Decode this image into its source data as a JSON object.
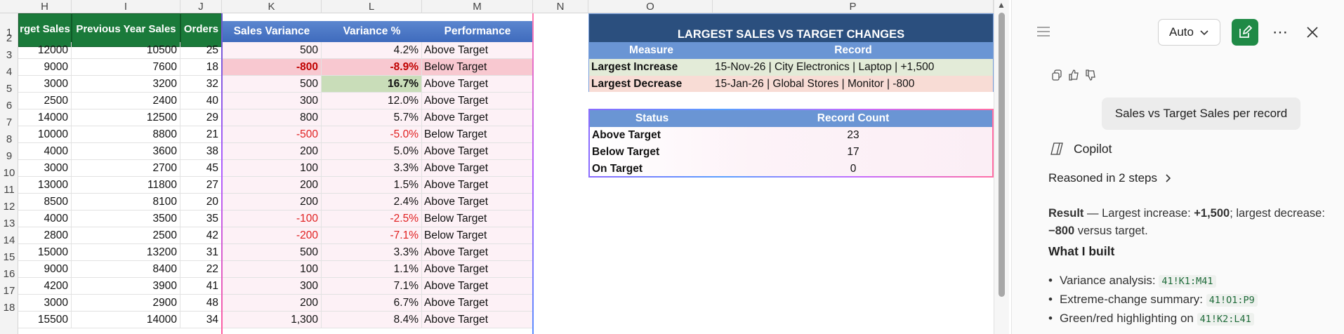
{
  "columns": [
    "H",
    "I",
    "J",
    "K",
    "L",
    "M",
    "N",
    "O",
    "P"
  ],
  "rows": [
    "1",
    "2",
    "3",
    "4",
    "5",
    "6",
    "7",
    "8",
    "9",
    "10",
    "11",
    "12",
    "13",
    "14",
    "15",
    "16",
    "17",
    "18"
  ],
  "headers": {
    "h": "rget Sales",
    "i": "Previous Year Sales",
    "j": "Orders",
    "k": "Sales Variance",
    "l": "Variance %",
    "m": "Performance"
  },
  "table_rows": [
    {
      "h": "12000",
      "i": "10500",
      "j": "25",
      "k": "500",
      "l": "4.2%",
      "m": "Above Target"
    },
    {
      "h": "9000",
      "i": "7600",
      "j": "18",
      "k": "-800",
      "l": "-8.9%",
      "m": "Below Target"
    },
    {
      "h": "3000",
      "i": "3200",
      "j": "32",
      "k": "500",
      "l": "16.7%",
      "m": "Above Target"
    },
    {
      "h": "2500",
      "i": "2400",
      "j": "40",
      "k": "300",
      "l": "12.0%",
      "m": "Above Target"
    },
    {
      "h": "14000",
      "i": "12500",
      "j": "29",
      "k": "800",
      "l": "5.7%",
      "m": "Above Target"
    },
    {
      "h": "10000",
      "i": "8800",
      "j": "21",
      "k": "-500",
      "l": "-5.0%",
      "m": "Below Target"
    },
    {
      "h": "4000",
      "i": "3600",
      "j": "38",
      "k": "200",
      "l": "5.0%",
      "m": "Above Target"
    },
    {
      "h": "3000",
      "i": "2700",
      "j": "45",
      "k": "100",
      "l": "3.3%",
      "m": "Above Target"
    },
    {
      "h": "13000",
      "i": "11800",
      "j": "27",
      "k": "200",
      "l": "1.5%",
      "m": "Above Target"
    },
    {
      "h": "8500",
      "i": "8100",
      "j": "20",
      "k": "200",
      "l": "2.4%",
      "m": "Above Target"
    },
    {
      "h": "4000",
      "i": "3500",
      "j": "35",
      "k": "-100",
      "l": "-2.5%",
      "m": "Below Target"
    },
    {
      "h": "2800",
      "i": "2500",
      "j": "42",
      "k": "-200",
      "l": "-7.1%",
      "m": "Below Target"
    },
    {
      "h": "15000",
      "i": "13200",
      "j": "31",
      "k": "500",
      "l": "3.3%",
      "m": "Above Target"
    },
    {
      "h": "9000",
      "i": "8400",
      "j": "22",
      "k": "100",
      "l": "1.1%",
      "m": "Above Target"
    },
    {
      "h": "4200",
      "i": "3900",
      "j": "41",
      "k": "300",
      "l": "7.1%",
      "m": "Above Target"
    },
    {
      "h": "3000",
      "i": "2900",
      "j": "48",
      "k": "200",
      "l": "6.7%",
      "m": "Above Target"
    },
    {
      "h": "15500",
      "i": "14000",
      "j": "34",
      "k": "1,300",
      "l": "8.4%",
      "m": "Above Target"
    }
  ],
  "summary": {
    "title": "LARGEST SALES VS TARGET CHANGES",
    "measure_header": "Measure",
    "record_header": "Record",
    "rows": [
      {
        "measure": "Largest Increase",
        "record": "15-Nov-26 | City Electronics | Laptop | +1,500"
      },
      {
        "measure": "Largest Decrease",
        "record": "15-Jan-26 | Global Stores | Monitor | -800"
      }
    ]
  },
  "status": {
    "status_header": "Status",
    "count_header": "Record Count",
    "rows": [
      {
        "status": "Above Target",
        "count": "23"
      },
      {
        "status": "Below Target",
        "count": "17"
      },
      {
        "status": "On Target",
        "count": "0"
      }
    ]
  },
  "copilot": {
    "mode_label": "Auto",
    "user_message": "Sales vs Target Sales per record",
    "name": "Copilot",
    "reasoned": "Reasoned in 2 steps",
    "result_prefix": "Result",
    "result_text_1": " — Largest increase: ",
    "result_increase": "+1,500",
    "result_text_2": "; largest decrease: ",
    "result_decrease": "−800",
    "result_text_3": " versus target.",
    "built_heading": "What I built",
    "bullets": [
      {
        "label": "Variance analysis: ",
        "code": "41!K1:M41"
      },
      {
        "label": "Extreme-change summary: ",
        "code": "41!O1:P9"
      },
      {
        "label": "Green/red highlighting on ",
        "code": "41!K2:L41"
      }
    ]
  },
  "colors": {
    "green_header": "#1a7a3a",
    "blue_header": "#4a78c4",
    "navy_title": "#2b4f7e",
    "negative_text": "#e02020",
    "pink_fill": "#f8c8d0",
    "green_fill": "#c9ddb9",
    "copilot_accent": "#1f8a46"
  },
  "icons": [
    "menu-icon",
    "chevron-down-icon",
    "compose-icon",
    "more-icon",
    "close-icon",
    "copy-icon",
    "thumbs-up-icon",
    "thumbs-down-icon",
    "copilot-icon",
    "chevron-right-icon"
  ]
}
